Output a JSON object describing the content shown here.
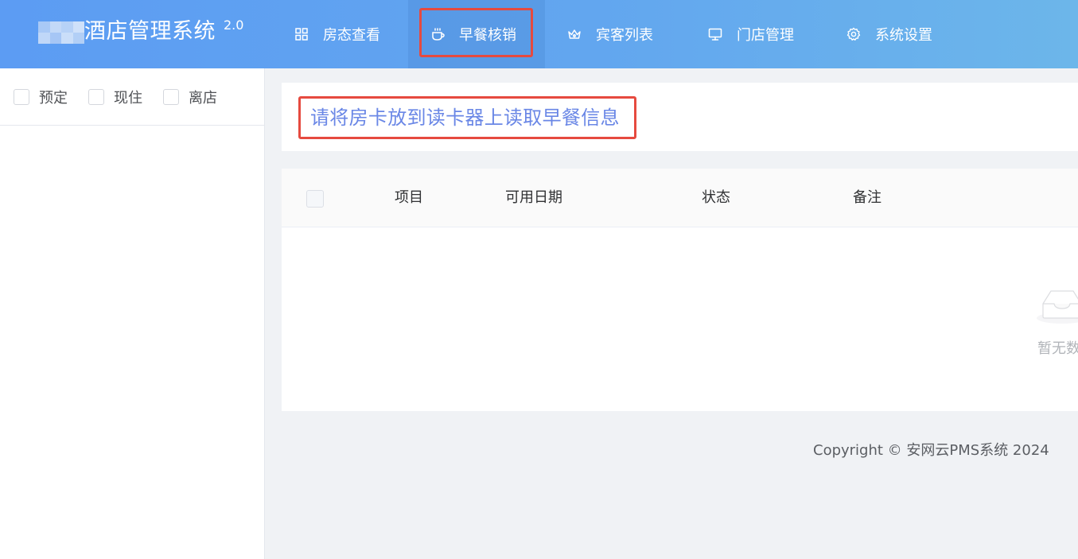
{
  "header": {
    "title": "酒店管理系统",
    "version": "2.0",
    "nav": [
      {
        "label": "房态查看",
        "icon": "grid-icon"
      },
      {
        "label": "早餐核销",
        "icon": "coffee-cup-icon",
        "active": true
      },
      {
        "label": "宾客列表",
        "icon": "crown-icon"
      },
      {
        "label": "门店管理",
        "icon": "monitor-icon"
      },
      {
        "label": "系统设置",
        "icon": "gear-icon"
      }
    ]
  },
  "sidebar": {
    "filters": [
      {
        "label": "预定",
        "checked": false
      },
      {
        "label": "现住",
        "checked": false
      },
      {
        "label": "离店",
        "checked": false
      }
    ]
  },
  "notice": {
    "text": "请将房卡放到读卡器上读取早餐信息"
  },
  "table": {
    "columns": [
      "项目",
      "可用日期",
      "状态",
      "备注"
    ],
    "empty_text": "暂无数据"
  },
  "footer": {
    "copyright": "Copyright © 安网云PMS系统 2024"
  },
  "colors": {
    "header_gradient_start": "#5c9cf3",
    "header_gradient_end": "#6cb6ea",
    "highlight_border": "#e64a3f",
    "notice_text": "#6a87e6"
  }
}
